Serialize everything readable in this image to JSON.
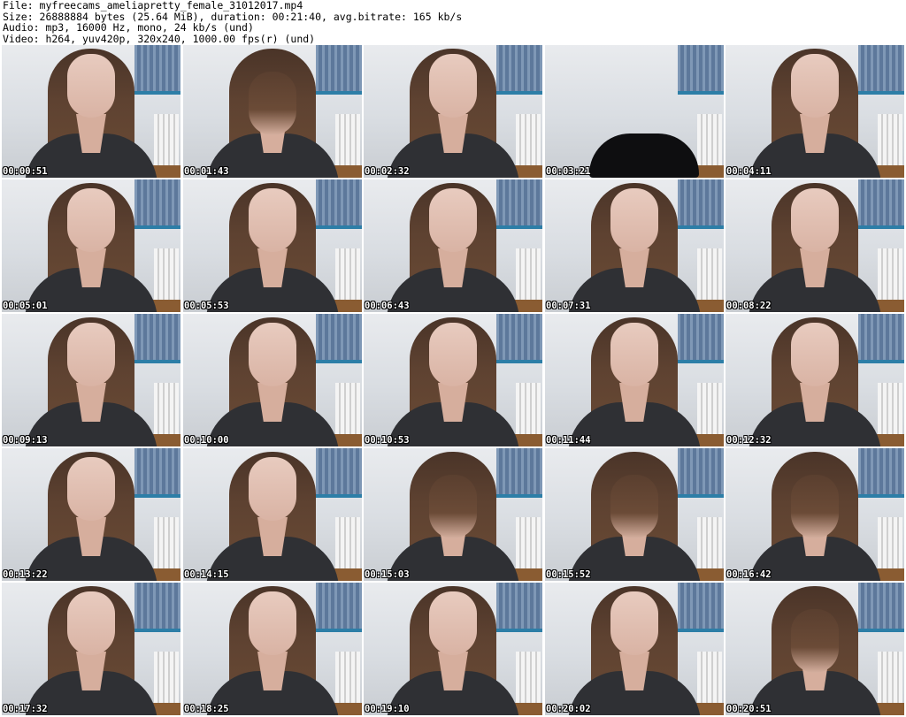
{
  "header": {
    "file": "File: myfreecams_ameliapretty_female_31012017.mp4",
    "size": "Size: 26888884 bytes (25.64 MiB), duration: 00:21:40, avg.bitrate: 165 kb/s",
    "audio": "Audio: mp3, 16000 Hz, mono, 24 kb/s (und)",
    "video": "Video: h264, yuv420p, 320x240, 1000.00 fps(r) (und)"
  },
  "thumbnails": [
    {
      "timestamp": "00:00:51"
    },
    {
      "timestamp": "00:01:43"
    },
    {
      "timestamp": "00:02:32"
    },
    {
      "timestamp": "00:03:21"
    },
    {
      "timestamp": "00:04:11"
    },
    {
      "timestamp": "00:05:01"
    },
    {
      "timestamp": "00:05:53"
    },
    {
      "timestamp": "00:06:43"
    },
    {
      "timestamp": "00:07:31"
    },
    {
      "timestamp": "00:08:22"
    },
    {
      "timestamp": "00:09:13"
    },
    {
      "timestamp": "00:10:00"
    },
    {
      "timestamp": "00:10:53"
    },
    {
      "timestamp": "00:11:44"
    },
    {
      "timestamp": "00:12:32"
    },
    {
      "timestamp": "00:13:22"
    },
    {
      "timestamp": "00:14:15"
    },
    {
      "timestamp": "00:15:03"
    },
    {
      "timestamp": "00:15:52"
    },
    {
      "timestamp": "00:16:42"
    },
    {
      "timestamp": "00:17:32"
    },
    {
      "timestamp": "00:18:25"
    },
    {
      "timestamp": "00:19:10"
    },
    {
      "timestamp": "00:20:02"
    },
    {
      "timestamp": "00:20:51"
    }
  ]
}
